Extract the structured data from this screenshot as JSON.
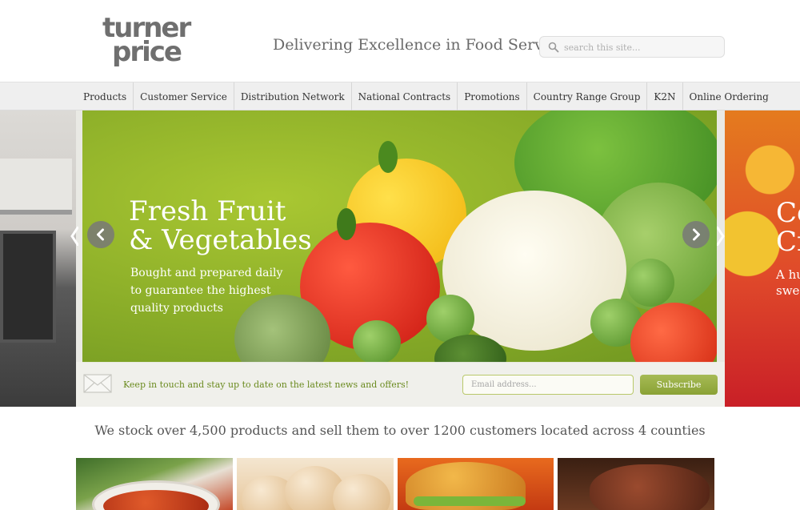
{
  "header": {
    "logo_line1": "turner",
    "logo_line2": "price",
    "tagline": "Delivering Excellence in Food Service",
    "search_placeholder": "search this site...",
    "search_icon": "search-icon"
  },
  "nav": {
    "items": [
      {
        "label": "Products"
      },
      {
        "label": "Customer Service"
      },
      {
        "label": "Distribution Network"
      },
      {
        "label": "National Contracts"
      },
      {
        "label": "Promotions"
      },
      {
        "label": "Country Range Group"
      },
      {
        "label": "K2N"
      },
      {
        "label": "Online Ordering"
      }
    ]
  },
  "hero": {
    "title_line1": "Fresh Fruit",
    "title_line2": "& Vegetables",
    "desc_line1": "Bought and prepared daily",
    "desc_line2": "to guarantee the highest",
    "desc_line3": "quality products",
    "next_peek_title_line1": "Co",
    "next_peek_title_line2": "Cr",
    "next_peek_sub_line1": "A hu",
    "next_peek_sub_line2": "swee",
    "prev_icon": "chevron-left-icon",
    "next_icon": "chevron-right-icon"
  },
  "newsletter": {
    "icon": "envelope-icon",
    "text": "Keep in touch and stay up to date on the latest news and offers!",
    "email_placeholder": "Email address...",
    "subscribe_label": "Subscribe"
  },
  "statement": "We stock over 4,500 products and sell them to over 1200 customers located across 4 counties",
  "colors": {
    "accent_green": "#8aa235",
    "newsletter_text": "#6a8a1e",
    "nav_bg": "#efefef"
  }
}
